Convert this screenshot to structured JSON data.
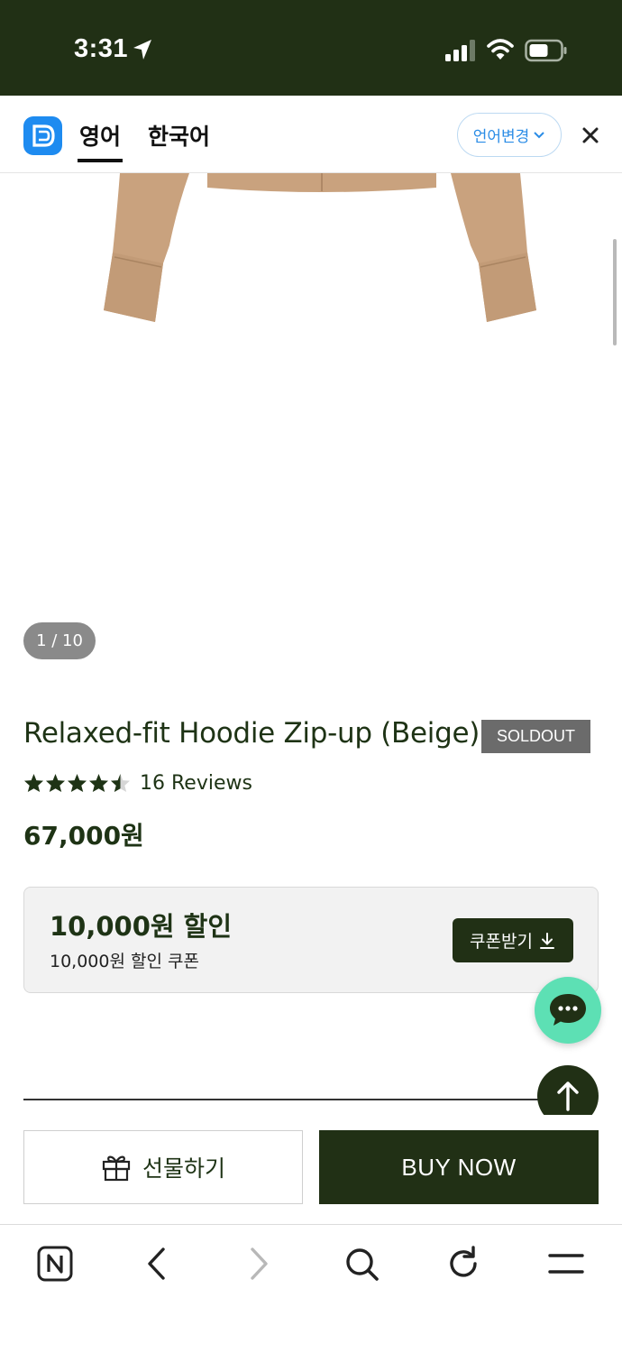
{
  "status_bar": {
    "time": "3:31",
    "icons": [
      "location-arrow-icon",
      "cellular-signal-icon",
      "wifi-icon",
      "battery-icon"
    ]
  },
  "translate_bar": {
    "logo_icon": "translator-logo-icon",
    "tabs": [
      {
        "label": "영어",
        "active": true
      },
      {
        "label": "한국어",
        "active": false
      }
    ],
    "change_language_label": "언어변경",
    "close_icon": "close-icon"
  },
  "gallery": {
    "counter": "1 / 10"
  },
  "product": {
    "title": "Relaxed-fit Hoodie Zip-up (Beige)",
    "badge": "SOLDOUT",
    "rating": 4.5,
    "reviews": "16 Reviews",
    "price": "67,000원"
  },
  "coupon": {
    "amount": "10,000원 할인",
    "description": "10,000원 할인 쿠폰",
    "button_label": "쿠폰받기"
  },
  "actions": {
    "gift_label": "선물하기",
    "buy_label": "BUY NOW"
  },
  "browser_toolbar": {
    "icons": [
      "naver-home-icon",
      "back-icon",
      "forward-icon",
      "search-icon",
      "refresh-icon",
      "menu-icon"
    ]
  },
  "colors": {
    "brand_dark_green": "#213015",
    "text_green": "#1e3315",
    "chat_mint": "#5de0b4",
    "translator_blue": "#1e8bf0",
    "product_beige": "#c9a27e"
  }
}
